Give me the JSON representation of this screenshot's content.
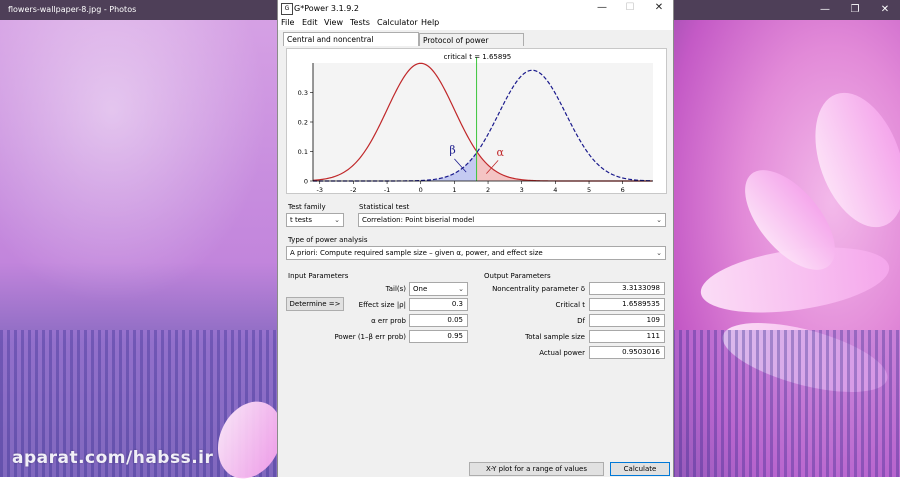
{
  "photos_app": {
    "title": "flowers-wallpaper-8.jpg - Photos",
    "controls": {
      "minimize": "—",
      "restore": "❐",
      "close": "✕"
    }
  },
  "watermark": "aparat.com/habss.ir",
  "gpower": {
    "title": "G*Power 3.1.9.2",
    "window_controls": {
      "minimize": "—",
      "maximize": "☐",
      "close": "✕"
    },
    "menu": [
      "File",
      "Edit",
      "View",
      "Tests",
      "Calculator",
      "Help"
    ],
    "tabs": [
      "Central and noncentral distributions",
      "Protocol of power analyses"
    ],
    "graph": {
      "critical_label": "critical t = 1.65895",
      "beta_symbol": "β",
      "alpha_symbol": "α",
      "x_ticks": [
        "-3",
        "-2",
        "-1",
        "0",
        "1",
        "2",
        "3",
        "4",
        "5",
        "6"
      ],
      "y_ticks": [
        "0",
        "0.1",
        "0.2",
        "0.3"
      ],
      "colors": {
        "central": "#c0282a",
        "noncentral": "#1a1a8c",
        "critical": "#3cc43c",
        "beta_fill": "#b8bff0",
        "alpha_fill": "#f4b8b8"
      }
    },
    "chart_data": {
      "type": "line",
      "series": [
        {
          "values_desc": "central t distribution",
          "df": 109,
          "ncp": 0
        },
        {
          "values_desc": "noncentral t distribution",
          "df": 109,
          "ncp": 3.3133098
        }
      ],
      "critical_t": 1.65895,
      "xlim": [
        -3.2,
        6.9
      ],
      "ylim": [
        0,
        0.4
      ]
    },
    "test_family": {
      "label": "Test family",
      "value": "t tests"
    },
    "statistical_test": {
      "label": "Statistical test",
      "value": "Correlation: Point biserial model"
    },
    "power_analysis": {
      "label": "Type of power analysis",
      "value": "A priori: Compute required sample size – given α, power, and effect size"
    },
    "input": {
      "heading": "Input Parameters",
      "tails_label": "Tail(s)",
      "tails_value": "One",
      "determine_button": "Determine =>",
      "effect_label": "Effect size |ρ|",
      "effect_value": "0.3",
      "alpha_label": "α err prob",
      "alpha_value": "0.05",
      "power_label": "Power (1–β err prob)",
      "power_value": "0.95"
    },
    "output": {
      "heading": "Output Parameters",
      "rows": [
        {
          "label": "Noncentrality parameter δ",
          "value": "3.3133098"
        },
        {
          "label": "Critical t",
          "value": "1.6589535"
        },
        {
          "label": "Df",
          "value": "109"
        },
        {
          "label": "Total sample size",
          "value": "111"
        },
        {
          "label": "Actual power",
          "value": "0.9503016"
        }
      ]
    },
    "buttons": {
      "xy_plot": "X-Y plot for a range of values",
      "calculate": "Calculate"
    }
  }
}
